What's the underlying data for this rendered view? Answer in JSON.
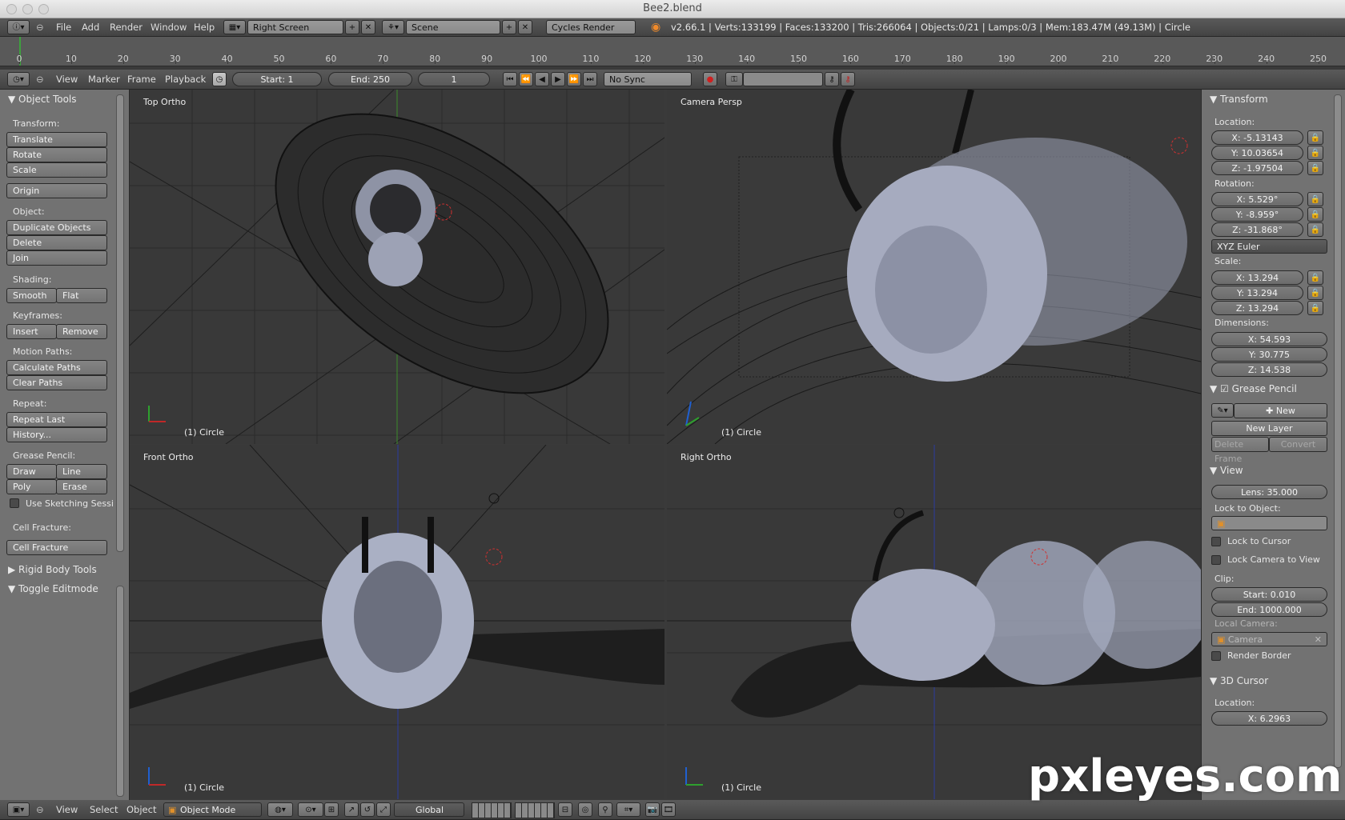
{
  "window": {
    "title": "Bee2.blend"
  },
  "info_header": {
    "menus": [
      "File",
      "Add",
      "Render",
      "Window",
      "Help"
    ],
    "screen": "Right Screen",
    "scene": "Scene",
    "render_engine": "Cycles Render",
    "stats": "v2.66.1 | Verts:133199 | Faces:133200 | Tris:266064 | Objects:0/21 | Lamps:0/3 | Mem:183.47M (49.13M) | Circle"
  },
  "timeline": {
    "ticks": [
      "0",
      "10",
      "20",
      "30",
      "40",
      "50",
      "60",
      "70",
      "80",
      "90",
      "100",
      "110",
      "120",
      "130",
      "140",
      "150",
      "160",
      "170",
      "180",
      "190",
      "200",
      "210",
      "220",
      "230",
      "240",
      "250"
    ],
    "menus": [
      "View",
      "Marker",
      "Frame",
      "Playback"
    ],
    "start": "Start: 1",
    "end": "End: 250",
    "current": "1",
    "sync": "No Sync"
  },
  "tool_shelf": {
    "title": "Object Tools",
    "transform_label": "Transform:",
    "translate": "Translate",
    "rotate": "Rotate",
    "scale": "Scale",
    "origin": "Origin",
    "object_label": "Object:",
    "duplicate": "Duplicate Objects",
    "delete": "Delete",
    "join": "Join",
    "shading_label": "Shading:",
    "smooth": "Smooth",
    "flat": "Flat",
    "keyframes_label": "Keyframes:",
    "insert": "Insert",
    "remove": "Remove",
    "motion_label": "Motion Paths:",
    "calc_paths": "Calculate Paths",
    "clear_paths": "Clear Paths",
    "repeat_label": "Repeat:",
    "repeat_last": "Repeat Last",
    "history": "History...",
    "grease_label": "Grease Pencil:",
    "draw": "Draw",
    "line": "Line",
    "poly": "Poly",
    "erase": "Erase",
    "sketching": "Use Sketching Sessi",
    "cell_label": "Cell Fracture:",
    "cell_fracture": "Cell Fracture",
    "rigid_body": "Rigid Body Tools",
    "toggle_editmode": "Toggle Editmode"
  },
  "viewports": {
    "top": {
      "label": "Top Ortho",
      "footer": "(1) Circle"
    },
    "camera": {
      "label": "Camera Persp",
      "footer": "(1) Circle"
    },
    "front": {
      "label": "Front Ortho",
      "footer": "(1) Circle"
    },
    "right": {
      "label": "Right Ortho",
      "footer": "(1) Circle"
    }
  },
  "properties": {
    "transform_title": "Transform",
    "location_label": "Location:",
    "loc_x": "X: -5.13143",
    "loc_y": "Y: 10.03654",
    "loc_z": "Z: -1.97504",
    "rotation_label": "Rotation:",
    "rot_x": "X: 5.529°",
    "rot_y": "Y: -8.959°",
    "rot_z": "Z: -31.868°",
    "rotation_mode": "XYZ Euler",
    "scale_label": "Scale:",
    "scale_x": "X: 13.294",
    "scale_y": "Y: 13.294",
    "scale_z": "Z: 13.294",
    "dimensions_label": "Dimensions:",
    "dim_x": "X: 54.593",
    "dim_y": "Y: 30.775",
    "dim_z": "Z: 14.538",
    "grease_title": "Grease Pencil",
    "gp_new": "New",
    "gp_new_layer": "New Layer",
    "gp_delete_frame": "Delete Frame",
    "gp_convert": "Convert",
    "view_title": "View",
    "lens": "Lens: 35.000",
    "lock_object_label": "Lock to Object:",
    "lock_cursor": "Lock to Cursor",
    "lock_camera": "Lock Camera to View",
    "clip_label": "Clip:",
    "clip_start": "Start: 0.010",
    "clip_end": "End: 1000.000",
    "local_camera_label": "Local Camera:",
    "local_camera": "Camera",
    "render_border": "Render Border",
    "cursor_title": "3D Cursor",
    "cursor_location_label": "Location:",
    "cursor_x": "X: 6.2963"
  },
  "bottom_header": {
    "menus": [
      "View",
      "Select",
      "Object"
    ],
    "mode": "Object Mode",
    "orientation": "Global"
  },
  "watermark": "pxleyes.com"
}
